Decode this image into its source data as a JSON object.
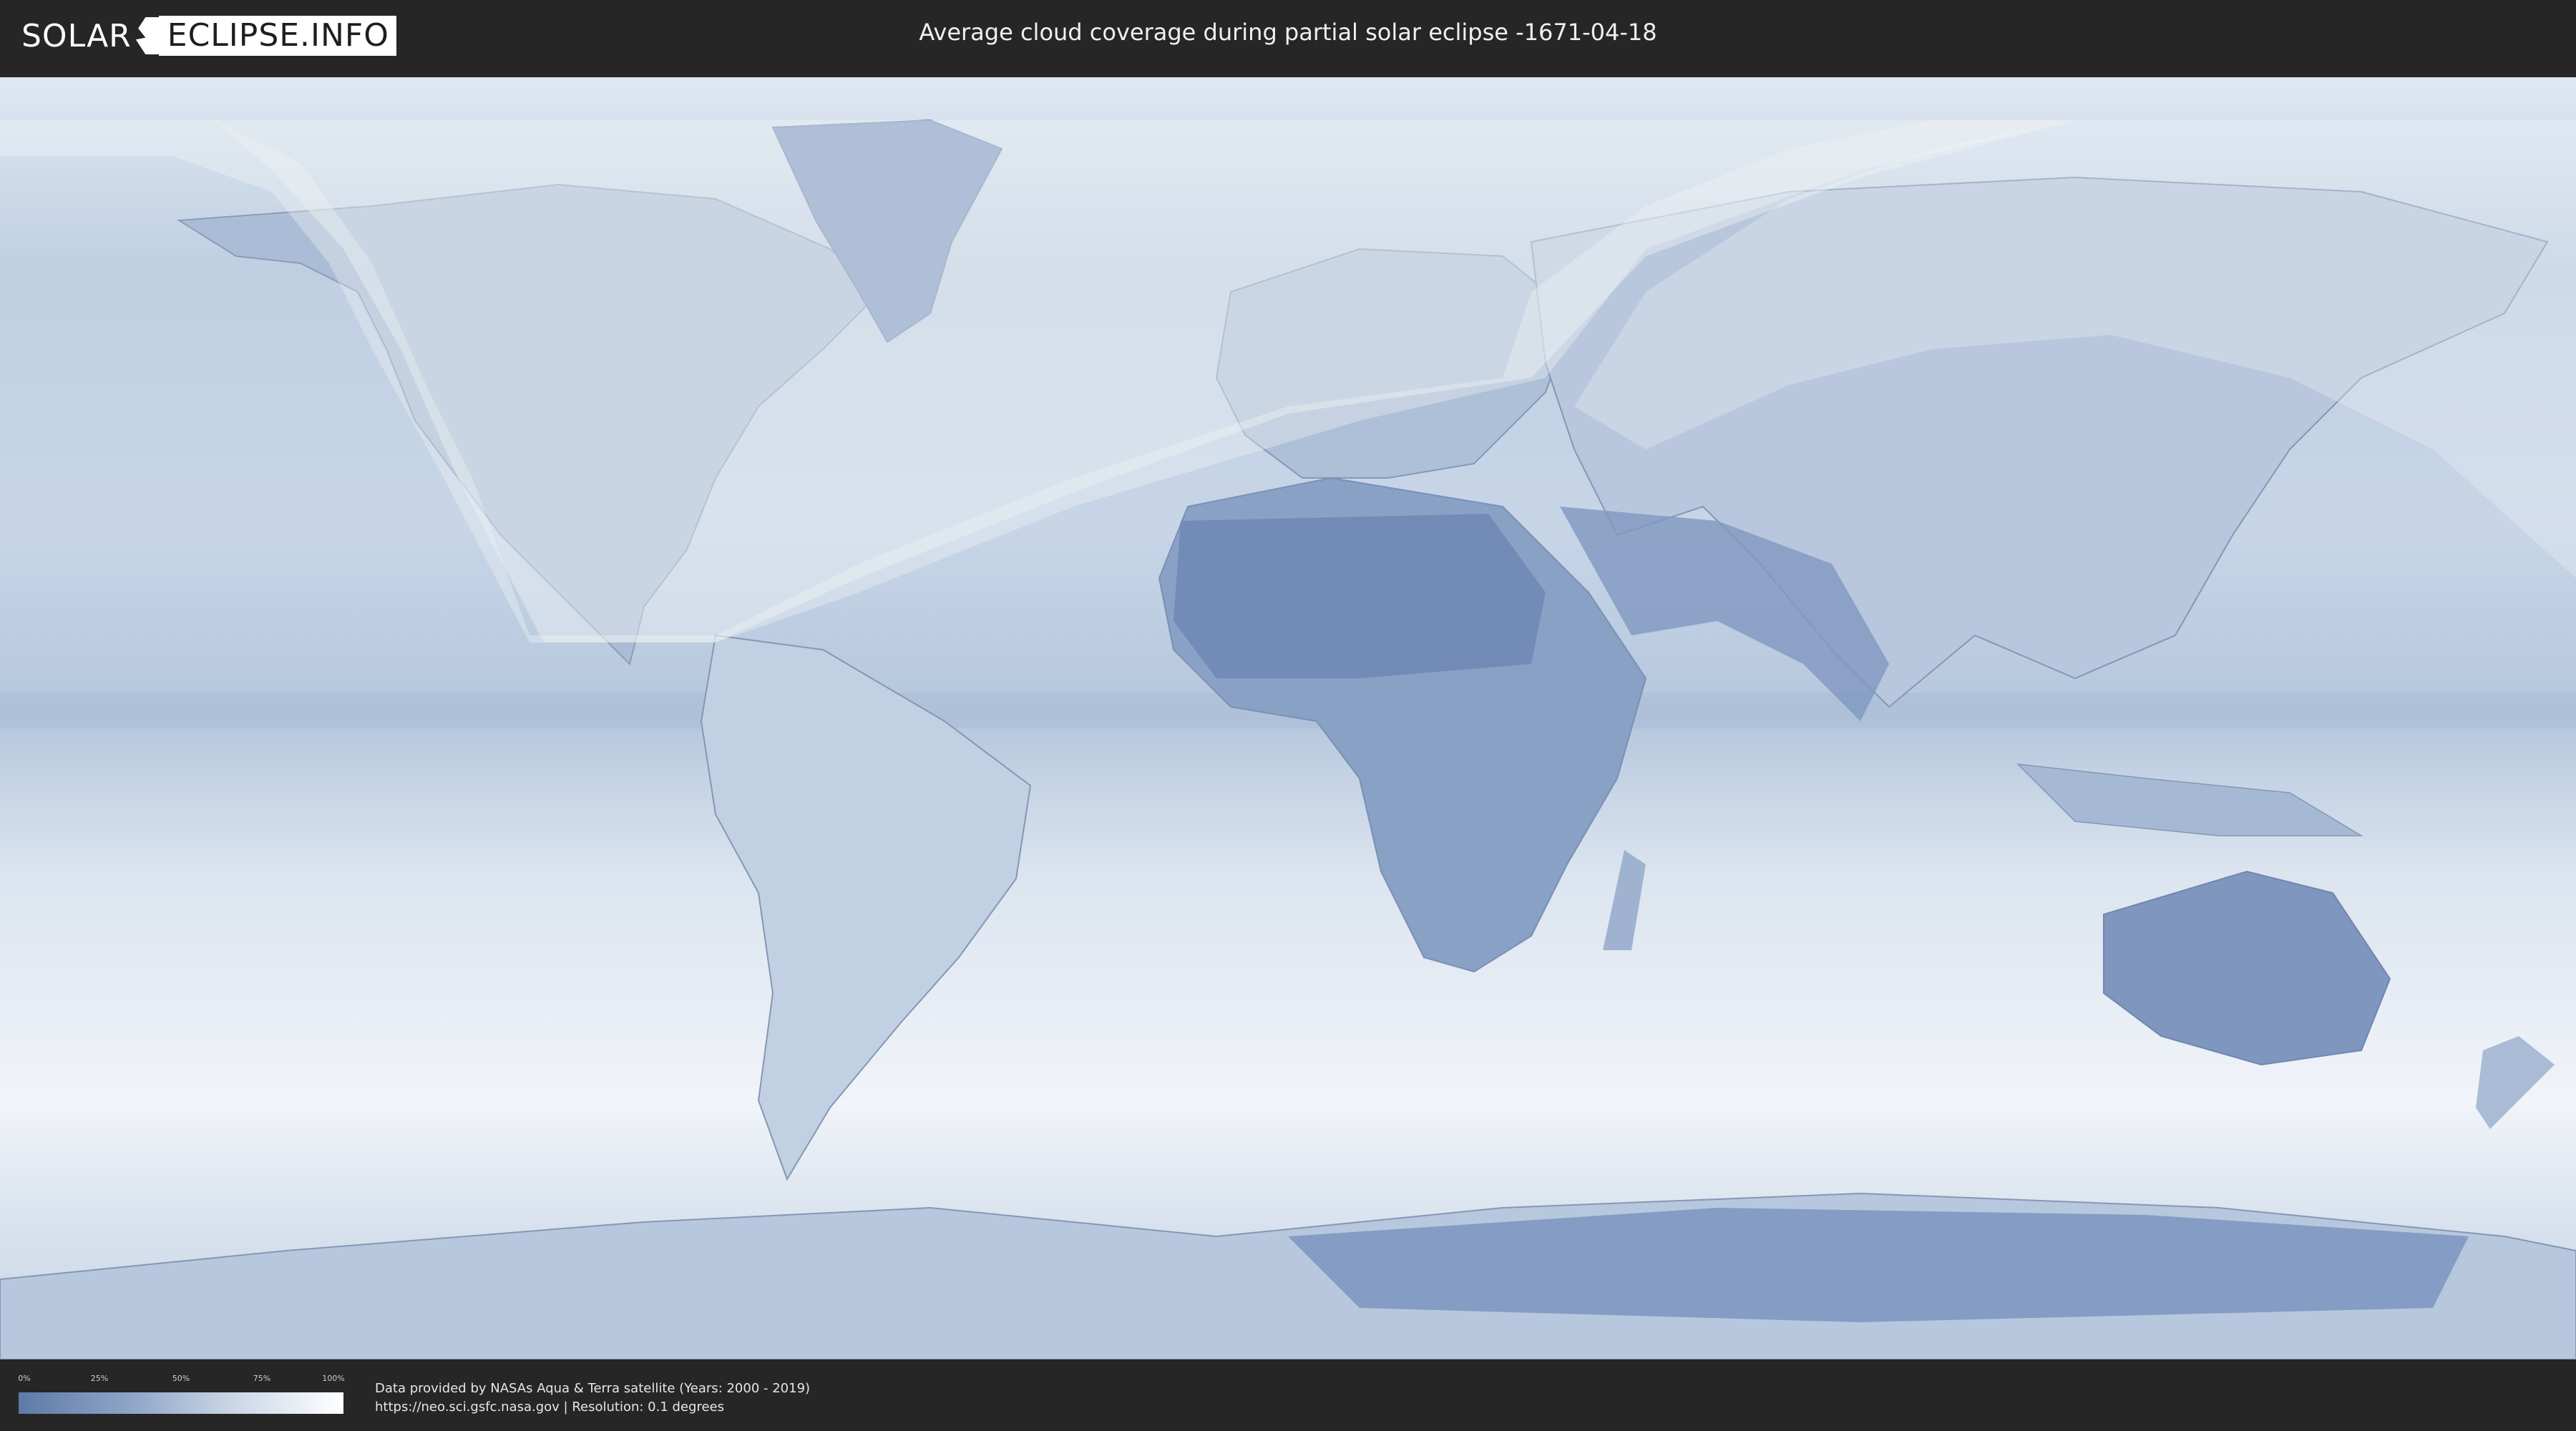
{
  "header": {
    "logo_part1": "SOLAR",
    "logo_part2": "ECLIPSE.INFO",
    "title": "Average cloud coverage during partial solar eclipse -1671-04-18"
  },
  "map": {
    "ocean_color": "#c9d6e8",
    "land_color": "#a8bbd6",
    "desert_color": "#7f97bf",
    "eclipse_overlay_color": "#f2f4f7"
  },
  "legend": {
    "ticks": [
      "0%",
      "25%",
      "50%",
      "75%",
      "100%"
    ],
    "gradient_start": "#5d7aa8",
    "gradient_end": "#ffffff"
  },
  "credits": {
    "line1": "Data provided by NASAs Aqua & Terra satellite (Years: 2000 - 2019)",
    "line2": "https://neo.sci.gsfc.nasa.gov | Resolution: 0.1 degrees"
  }
}
